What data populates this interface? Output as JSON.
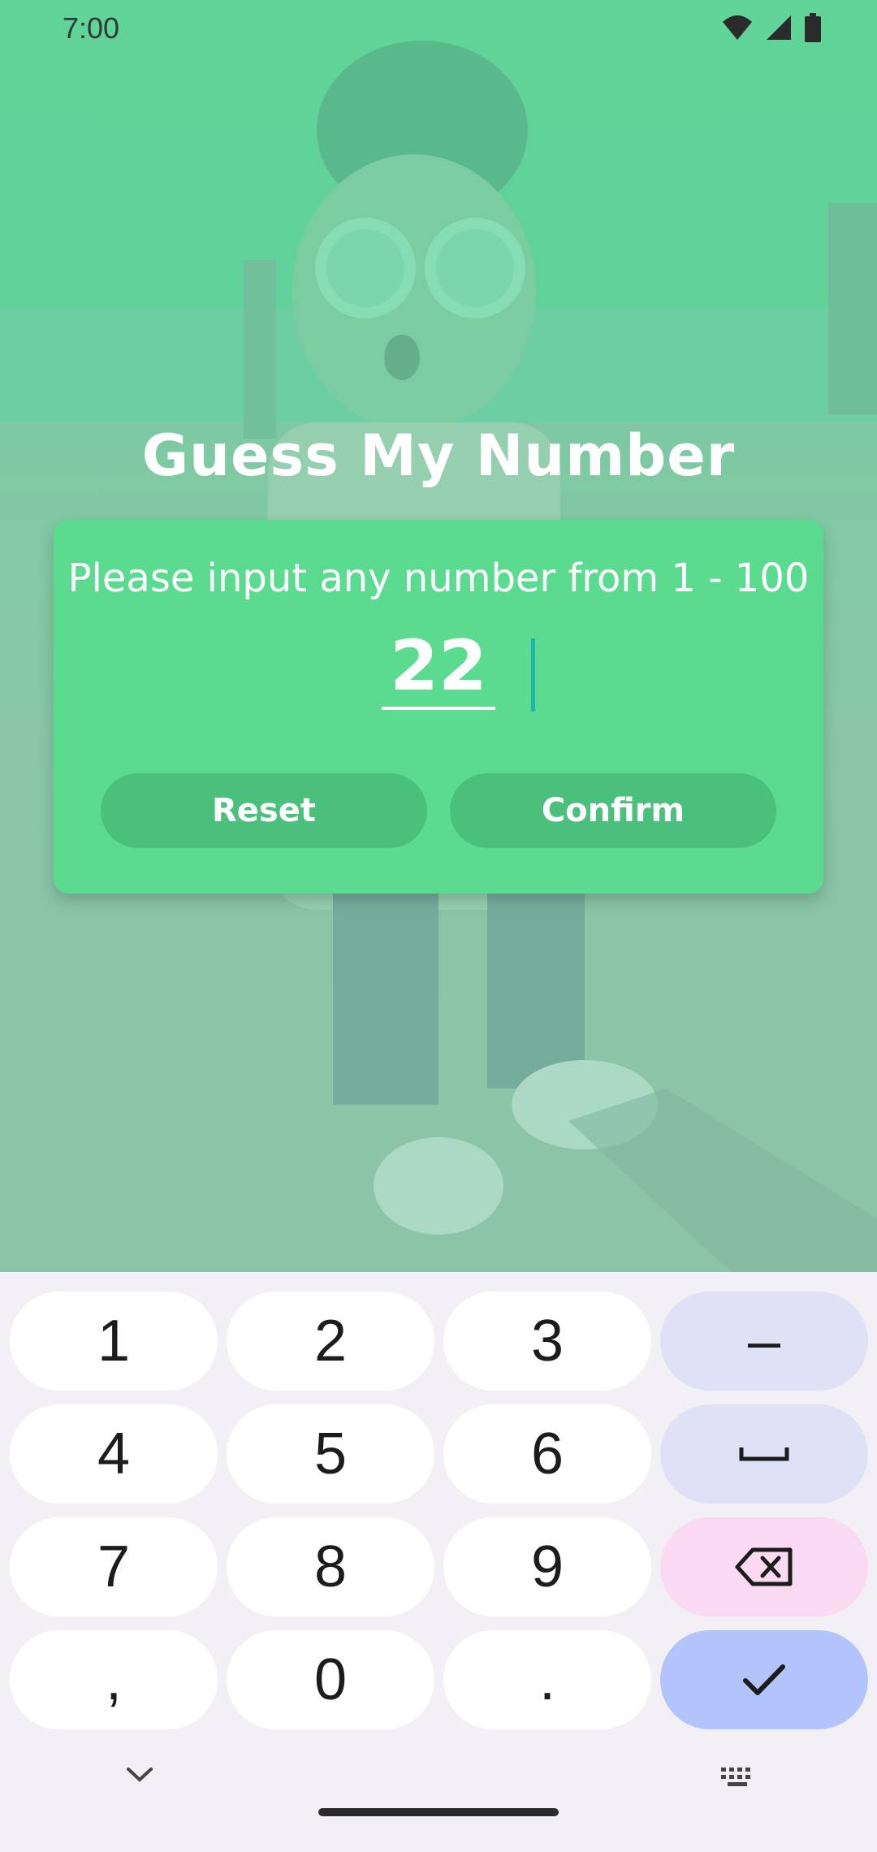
{
  "status": {
    "time": "7:00",
    "icons": [
      "wifi-icon",
      "signal-icon",
      "battery-icon"
    ]
  },
  "app": {
    "title": "Guess My Number"
  },
  "card": {
    "prompt": "Please input any number from 1 - 100",
    "input_value": "22",
    "reset_label": "Reset",
    "confirm_label": "Confirm"
  },
  "keyboard": {
    "rows": [
      [
        "1",
        "2",
        "3",
        "–"
      ],
      [
        "4",
        "5",
        "6",
        "␣"
      ],
      [
        "7",
        "8",
        "9",
        "⌫"
      ],
      [
        ",",
        "0",
        ".",
        "✓"
      ]
    ],
    "k1": "1",
    "k2": "2",
    "k3": "3",
    "kminus": "–",
    "k4": "4",
    "k5": "5",
    "k6": "6",
    "k7": "7",
    "k8": "8",
    "k9": "9",
    "kcomma": ",",
    "k0": "0",
    "kdot": "."
  },
  "colors": {
    "card": "#5bdb8f",
    "button": "#4bc07c",
    "accent_caret": "#1fb6a6",
    "key_func": "#dfe2f6",
    "key_delete": "#fad9f2",
    "key_confirm": "#b2c4fb"
  }
}
